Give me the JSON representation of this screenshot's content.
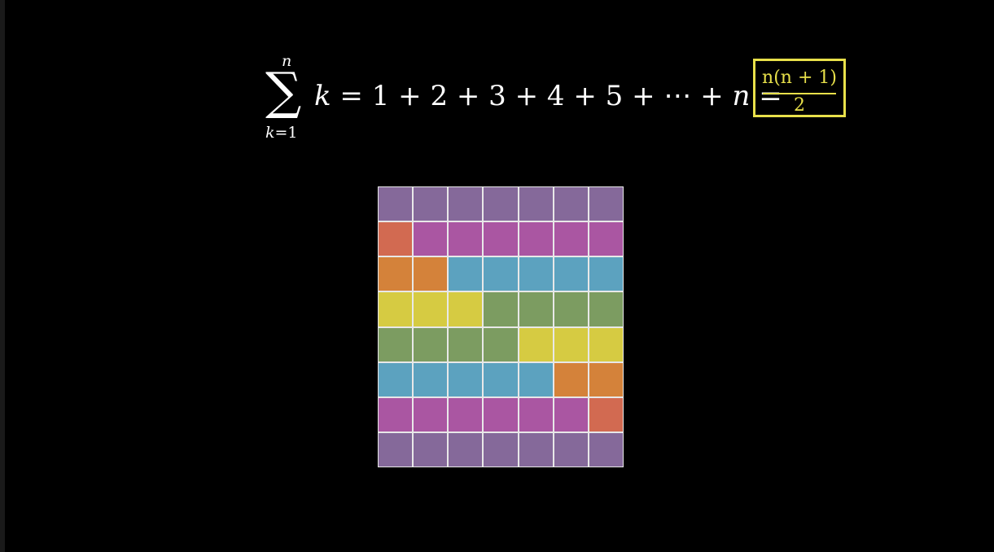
{
  "formula": {
    "sigma_upper": "n",
    "sigma_symbol": "∑",
    "sigma_lower_var": "k",
    "sigma_lower_rest": "=1",
    "lhs_var": "k",
    "expansion": " = 1 + 2 + 3 + 4 + 5 + ⋯ + ",
    "last_term": "n",
    "equals": " =",
    "result_numerator": "n(n + 1)",
    "result_denominator": "2",
    "result_color": "#e8e04a"
  },
  "grid": {
    "columns": 7,
    "rows": 8,
    "palette": {
      "purple": "#85699a",
      "magenta": "#aa56a2",
      "red": "#d26a51",
      "orange": "#d4823a",
      "blue": "#5ca2bf",
      "yellow": "#d6cb42",
      "green": "#7c9c61"
    },
    "cells": [
      [
        "purple",
        "purple",
        "purple",
        "purple",
        "purple",
        "purple",
        "purple"
      ],
      [
        "red",
        "magenta",
        "magenta",
        "magenta",
        "magenta",
        "magenta",
        "magenta"
      ],
      [
        "orange",
        "orange",
        "blue",
        "blue",
        "blue",
        "blue",
        "blue"
      ],
      [
        "yellow",
        "yellow",
        "yellow",
        "green",
        "green",
        "green",
        "green"
      ],
      [
        "green",
        "green",
        "green",
        "green",
        "yellow",
        "yellow",
        "yellow"
      ],
      [
        "blue",
        "blue",
        "blue",
        "blue",
        "blue",
        "orange",
        "orange"
      ],
      [
        "magenta",
        "magenta",
        "magenta",
        "magenta",
        "magenta",
        "magenta",
        "red"
      ],
      [
        "purple",
        "purple",
        "purple",
        "purple",
        "purple",
        "purple",
        "purple"
      ]
    ]
  }
}
